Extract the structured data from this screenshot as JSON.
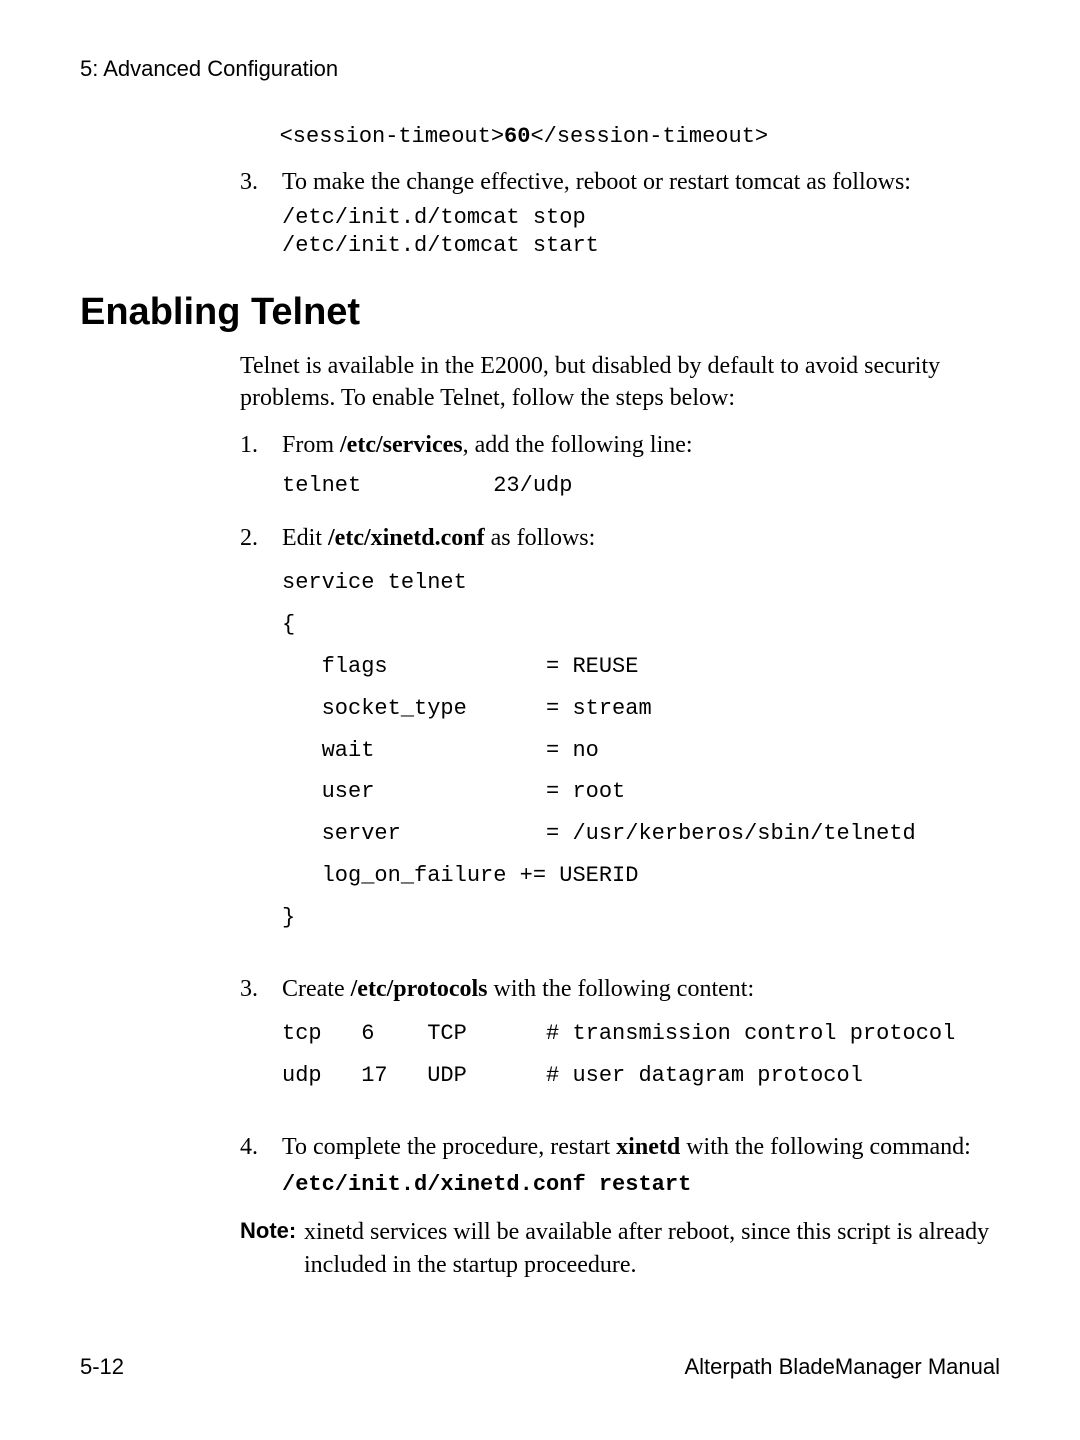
{
  "running_head": "5: Advanced Configuration",
  "pre_code_line": "   <session-timeout>60</session-timeout>",
  "pre_code_value": "60",
  "step3a": {
    "num": "3.",
    "text": "To make the change effective, reboot or restart tomcat as follows:",
    "code": "/etc/init.d/tomcat stop\n/etc/init.d/tomcat start"
  },
  "heading": "Enabling Telnet",
  "intro": "Telnet is available in the E2000, but disabled by default to avoid security problems. To enable Telnet, follow the steps below:",
  "telnet_steps": {
    "s1": {
      "num": "1.",
      "pre": "From ",
      "bold": "/etc/services",
      "post": ", add the following line:",
      "code": "telnet          23/udp"
    },
    "s2": {
      "num": "2.",
      "pre": "Edit ",
      "bold": "/etc/xinetd.conf",
      "post": " as follows:",
      "code": "service telnet\n{\n   flags            = REUSE\n   socket_type      = stream\n   wait             = no\n   user             = root\n   server           = /usr/kerberos/sbin/telnetd\n   log_on_failure += USERID\n}"
    },
    "s3": {
      "num": "3.",
      "pre": "Create ",
      "bold": "/etc/protocols",
      "post": " with the following content:",
      "code": "tcp   6    TCP      # transmission control protocol\nudp   17   UDP      # user datagram protocol"
    },
    "s4": {
      "num": "4.",
      "pre": "To complete the procedure, restart ",
      "bold": "xinetd",
      "post": " with the following command:",
      "code": "/etc/init.d/xinetd.conf restart"
    }
  },
  "note": {
    "label": "Note:",
    "text": "xinetd services will be available after reboot, since this script is already included in the startup proceedure."
  },
  "footer_left": "5-12",
  "footer_right": "Alterpath BladeManager Manual"
}
